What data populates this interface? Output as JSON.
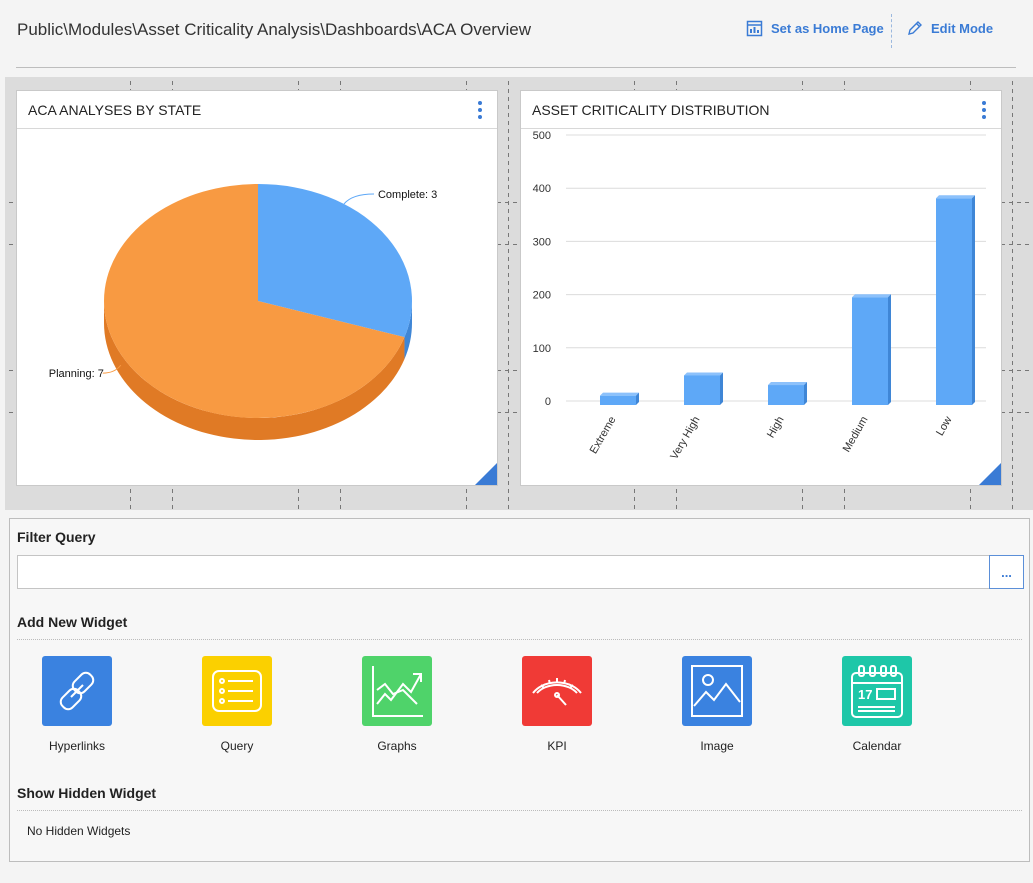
{
  "header": {
    "breadcrumb": "Public\\Modules\\Asset Criticality Analysis\\Dashboards\\ACA Overview",
    "set_home_label": "Set as Home Page",
    "edit_mode_label": "Edit Mode"
  },
  "widgets": {
    "pie": {
      "title": "ACA ANALYSES BY STATE",
      "colors": {
        "planning": "#f89a42",
        "complete": "#5ea8f7"
      }
    },
    "bar": {
      "title": "ASSET CRITICALITY DISTRIBUTION",
      "color": "#5ea8f7"
    }
  },
  "chart_data": [
    {
      "type": "pie",
      "slices": [
        {
          "label": "Complete: 3",
          "value": 3
        },
        {
          "label": "Planning: 7",
          "value": 7
        }
      ]
    },
    {
      "type": "bar",
      "categories": [
        "Extreme",
        "Very High",
        "High",
        "Medium",
        "Low"
      ],
      "values": [
        10,
        48,
        30,
        195,
        381
      ],
      "yticks": [
        "0",
        "100",
        "200",
        "300",
        "400",
        "500"
      ],
      "ylim": [
        0,
        500
      ],
      "grid": true
    }
  ],
  "panel": {
    "filter_title": "Filter Query",
    "filter_value": "",
    "filter_button": "...",
    "add_widget_title": "Add New Widget",
    "tiles": [
      {
        "label": "Hyperlinks",
        "color": "#3a82e0"
      },
      {
        "label": "Query",
        "color": "#fbd000"
      },
      {
        "label": "Graphs",
        "color": "#4fd36a"
      },
      {
        "label": "KPI",
        "color": "#f03a36"
      },
      {
        "label": "Image",
        "color": "#3a82e0"
      },
      {
        "label": "Calendar",
        "color": "#1ec7a8"
      }
    ],
    "hidden_title": "Show Hidden Widget",
    "no_hidden": "No Hidden Widgets"
  }
}
